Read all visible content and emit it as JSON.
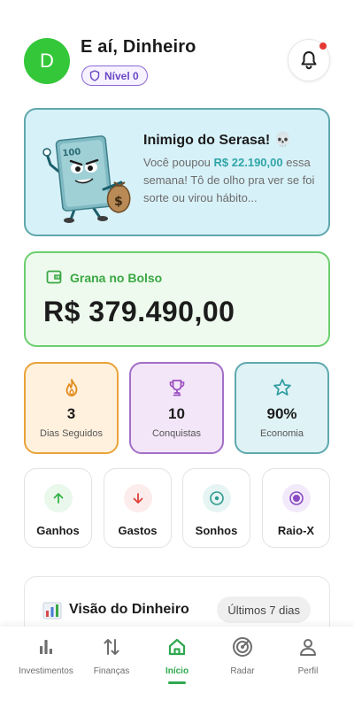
{
  "header": {
    "avatar_initial": "D",
    "greeting": "E aí, Dinheiro",
    "level_label": "Nível 0"
  },
  "enemy_card": {
    "title": "Inimigo do Serasa! 💀",
    "text_before": "Você poupou ",
    "amount": "R$ 22.190,00",
    "text_after": " essa semana! Tô de olho pra ver se foi sorte ou virou hábito..."
  },
  "balance": {
    "label": "Grana no Bolso",
    "value": "R$ 379.490,00"
  },
  "stats": [
    {
      "value": "3",
      "label": "Dias Seguidos",
      "icon": "fire-icon"
    },
    {
      "value": "10",
      "label": "Conquistas",
      "icon": "trophy-icon"
    },
    {
      "value": "90%",
      "label": "Economia",
      "icon": "star-icon"
    }
  ],
  "actions": [
    {
      "label": "Ganhos",
      "icon": "arrow-up-icon"
    },
    {
      "label": "Gastos",
      "icon": "arrow-down-icon"
    },
    {
      "label": "Sonhos",
      "icon": "target-icon"
    },
    {
      "label": "Raio-X",
      "icon": "radio-button-icon"
    }
  ],
  "vision": {
    "title": "Visão do Dinheiro",
    "period": "Últimos 7 dias"
  },
  "tabs": [
    {
      "label": "Investimentos",
      "icon": "bar-chart-icon"
    },
    {
      "label": "Finanças",
      "icon": "swap-vertical-icon"
    },
    {
      "label": "Início",
      "icon": "home-icon",
      "active": true
    },
    {
      "label": "Radar",
      "icon": "radar-icon"
    },
    {
      "label": "Perfil",
      "icon": "person-icon"
    }
  ],
  "colors": {
    "primary_green": "#35c73a",
    "accent_teal": "#2fa5a8",
    "level_purple": "#6a48c3",
    "notification_red": "#e53935"
  }
}
